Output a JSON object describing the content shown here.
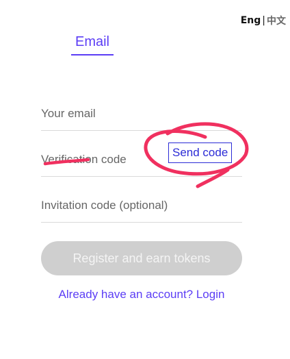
{
  "language": {
    "current": "Eng",
    "separator": "|",
    "alternate": "中文"
  },
  "tabs": {
    "active_label": "Email"
  },
  "form": {
    "email_placeholder": "Your email",
    "verification_placeholder": "Verification code",
    "send_code_label": "Send code",
    "invitation_placeholder": "Invitation code (optional)"
  },
  "actions": {
    "register_label": "Register and earn tokens",
    "login_link": "Already have an account? Login"
  },
  "colors": {
    "accent": "#5b3df5",
    "send_code": "#2b2bd6",
    "register_disabled": "#cfcfcf",
    "annotation": "#f0305f"
  }
}
